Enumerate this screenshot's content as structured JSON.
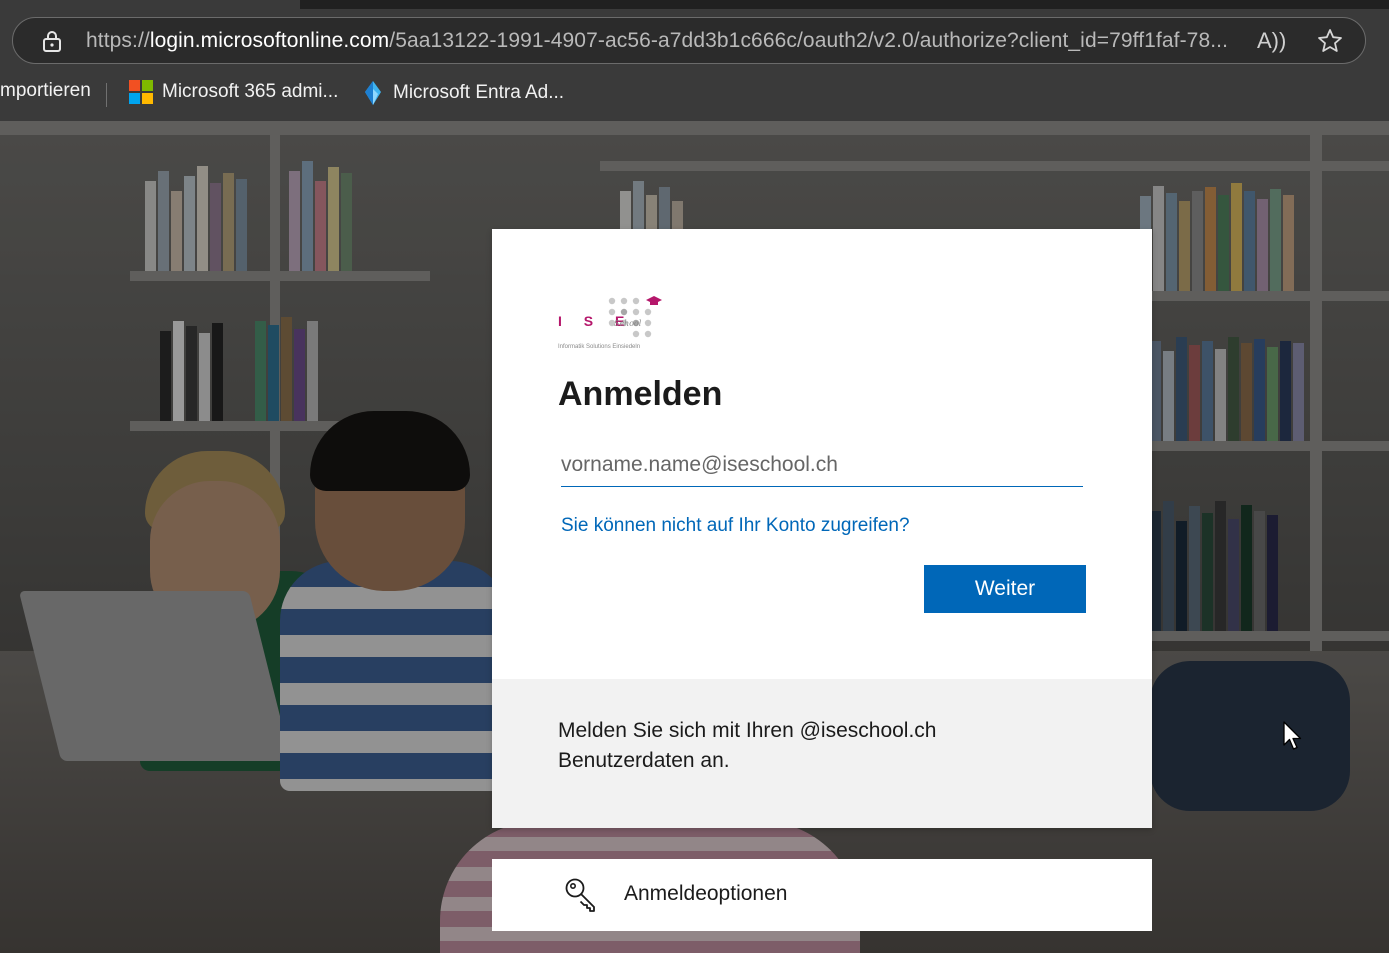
{
  "browser": {
    "url_prefix": "https://",
    "url_domain": "login.microsoftonline.com",
    "url_path": "/5aa13122-1991-4907-ac56-a7dd3b1c666c/oauth2/v2.0/authorize?client_id=79ff1faf-78...",
    "read_aloud_glyph": "A))",
    "bookmarks": [
      {
        "label": "mportieren"
      },
      {
        "label": "Microsoft 365 admi...",
        "icon": "microsoft-logo-icon"
      },
      {
        "label": "Microsoft Entra Ad...",
        "icon": "entra-icon"
      }
    ]
  },
  "signin": {
    "logo_letters": "I S E",
    "logo_script": "School",
    "logo_subtitle": "Informatik Solutions Einsiedeln",
    "title": "Anmelden",
    "email_placeholder": "vorname.name@iseschool.ch",
    "forgot_link": "Sie können nicht auf Ihr Konto zugreifen?",
    "next_button": "Weiter",
    "footer_text": "Melden Sie sich mit Ihren @iseschool.ch Benutzerdaten an.",
    "options_label": "Anmeldeoptionen"
  },
  "colors": {
    "accent": "#0067b8",
    "logo_magenta": "#b5176b",
    "footer_bg": "#f2f2f2"
  }
}
